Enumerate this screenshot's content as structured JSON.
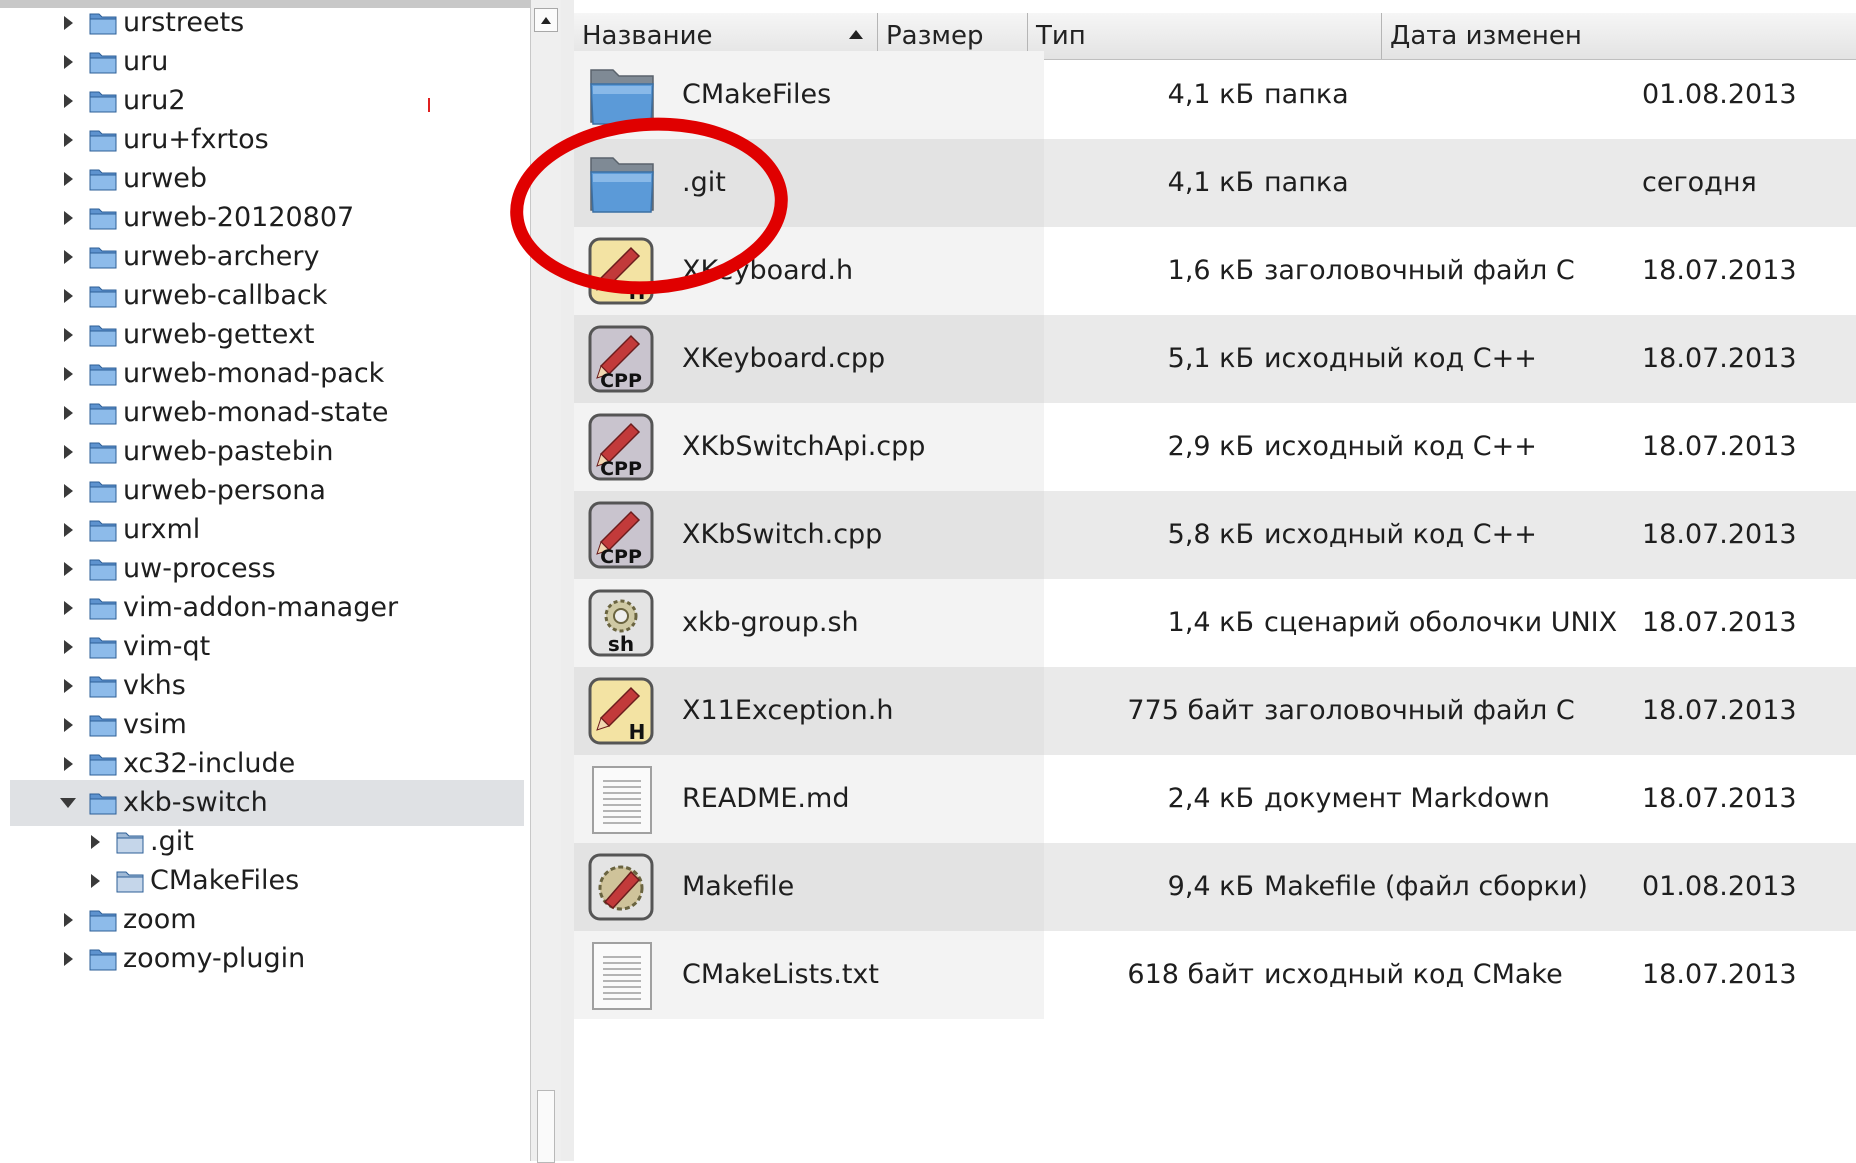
{
  "tree": {
    "items": [
      {
        "label": "urstreets",
        "depth": 0,
        "expanded": false,
        "selected": false
      },
      {
        "label": "uru",
        "depth": 0,
        "expanded": false,
        "selected": false
      },
      {
        "label": "uru2",
        "depth": 0,
        "expanded": false,
        "selected": false
      },
      {
        "label": "uru+fxrtos",
        "depth": 0,
        "expanded": false,
        "selected": false
      },
      {
        "label": "urweb",
        "depth": 0,
        "expanded": false,
        "selected": false
      },
      {
        "label": "urweb-20120807",
        "depth": 0,
        "expanded": false,
        "selected": false
      },
      {
        "label": "urweb-archery",
        "depth": 0,
        "expanded": false,
        "selected": false
      },
      {
        "label": "urweb-callback",
        "depth": 0,
        "expanded": false,
        "selected": false
      },
      {
        "label": "urweb-gettext",
        "depth": 0,
        "expanded": false,
        "selected": false
      },
      {
        "label": "urweb-monad-pack",
        "depth": 0,
        "expanded": false,
        "selected": false
      },
      {
        "label": "urweb-monad-state",
        "depth": 0,
        "expanded": false,
        "selected": false
      },
      {
        "label": "urweb-pastebin",
        "depth": 0,
        "expanded": false,
        "selected": false
      },
      {
        "label": "urweb-persona",
        "depth": 0,
        "expanded": false,
        "selected": false
      },
      {
        "label": "urxml",
        "depth": 0,
        "expanded": false,
        "selected": false
      },
      {
        "label": "uw-process",
        "depth": 0,
        "expanded": false,
        "selected": false
      },
      {
        "label": "vim-addon-manager",
        "depth": 0,
        "expanded": false,
        "selected": false
      },
      {
        "label": "vim-qt",
        "depth": 0,
        "expanded": false,
        "selected": false
      },
      {
        "label": "vkhs",
        "depth": 0,
        "expanded": false,
        "selected": false
      },
      {
        "label": "vsim",
        "depth": 0,
        "expanded": false,
        "selected": false
      },
      {
        "label": "xc32-include",
        "depth": 0,
        "expanded": false,
        "selected": false
      },
      {
        "label": "xkb-switch",
        "depth": 0,
        "expanded": true,
        "selected": true
      },
      {
        "label": ".git",
        "depth": 1,
        "expanded": false,
        "selected": false
      },
      {
        "label": "CMakeFiles",
        "depth": 1,
        "expanded": false,
        "selected": false
      },
      {
        "label": "zoom",
        "depth": 0,
        "expanded": false,
        "selected": false
      },
      {
        "label": "zoomy-plugin",
        "depth": 0,
        "expanded": false,
        "selected": false
      }
    ]
  },
  "list": {
    "columns": {
      "name": "Название",
      "size": "Размер",
      "type": "Тип",
      "date": "Дата изменен"
    },
    "sort": "ascending",
    "rows": [
      {
        "name": "CMakeFiles",
        "size": "4,1 кБ",
        "type": "папка",
        "date": "01.08.2013",
        "icon": "folder-icon"
      },
      {
        "name": ".git",
        "size": "4,1 кБ",
        "type": "папка",
        "date": "сегодня",
        "icon": "folder-icon"
      },
      {
        "name": "XKeyboard.h",
        "size": "1,6 кБ",
        "type": "заголовочный файл C",
        "date": "18.07.2013",
        "icon": "header-file-icon"
      },
      {
        "name": "XKeyboard.cpp",
        "size": "5,1 кБ",
        "type": "исходный код C++",
        "date": "18.07.2013",
        "icon": "cpp-file-icon"
      },
      {
        "name": "XKbSwitchApi.cpp",
        "size": "2,9 кБ",
        "type": "исходный код C++",
        "date": "18.07.2013",
        "icon": "cpp-file-icon"
      },
      {
        "name": "XKbSwitch.cpp",
        "size": "5,8 кБ",
        "type": "исходный код C++",
        "date": "18.07.2013",
        "icon": "cpp-file-icon"
      },
      {
        "name": "xkb-group.sh",
        "size": "1,4 кБ",
        "type": "сценарий оболочки UNIX",
        "date": "18.07.2013",
        "icon": "shell-script-icon"
      },
      {
        "name": "X11Exception.h",
        "size": "775 байт",
        "type": "заголовочный файл C",
        "date": "18.07.2013",
        "icon": "header-file-icon"
      },
      {
        "name": "README.md",
        "size": "2,4 кБ",
        "type": "документ Markdown",
        "date": "18.07.2013",
        "icon": "text-file-icon"
      },
      {
        "name": "Makefile",
        "size": "9,4 кБ",
        "type": "Makefile (файл сборки)",
        "date": "01.08.2013",
        "icon": "makefile-icon"
      },
      {
        "name": "CMakeLists.txt",
        "size": "618 байт",
        "type": "исходный код CMake",
        "date": "18.07.2013",
        "icon": "text-file-icon"
      }
    ]
  },
  "annotation": {
    "color": "#e00000",
    "target": ".git"
  },
  "colors": {
    "folder": "#4a90d9",
    "header_icon": "#f3e3a3",
    "cpp_icon": "#c9c4ce",
    "selection": "#dfe1e4"
  }
}
